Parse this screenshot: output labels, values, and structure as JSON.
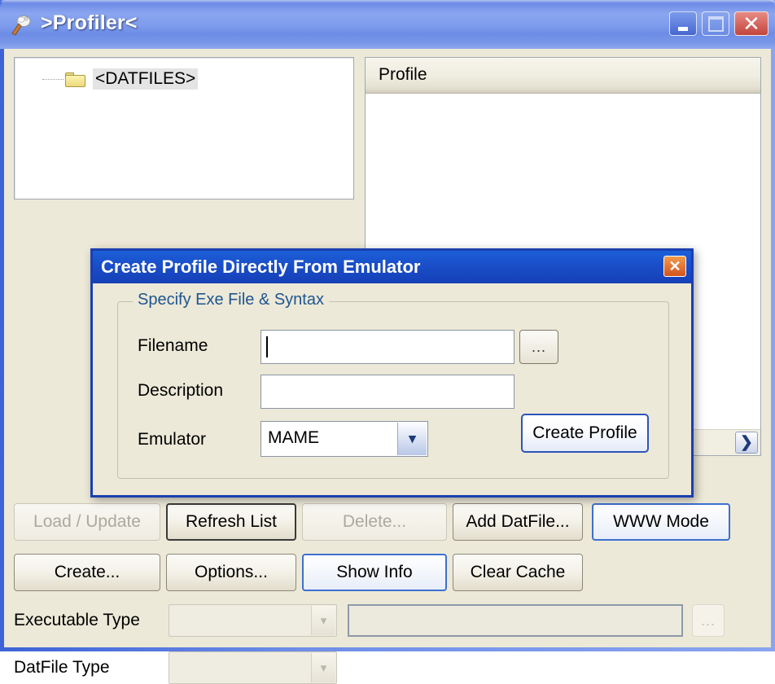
{
  "window": {
    "title": ">Profiler<",
    "icon": "app-icon",
    "controls": {
      "minimize": "minimize-icon",
      "maximize": "maximize-icon",
      "close": "close-icon"
    }
  },
  "tree_panel": {
    "nodes": [
      {
        "label": "<DATFILES>",
        "icon": "folder-icon",
        "selected": true
      }
    ]
  },
  "list_panel": {
    "column_header": "Profile",
    "rows": [],
    "hscroll_right_glyph": "❯"
  },
  "button_rows": {
    "row1": [
      {
        "label": "Load / Update",
        "state": "disabled"
      },
      {
        "label": "Refresh List",
        "state": "default"
      },
      {
        "label": "Delete...",
        "state": "disabled"
      },
      {
        "label": "Add DatFile...",
        "state": "normal"
      },
      {
        "label": "WWW Mode",
        "state": "focus"
      }
    ],
    "row2": [
      {
        "label": "Create...",
        "state": "normal"
      },
      {
        "label": "Options...",
        "state": "normal"
      },
      {
        "label": "Show Info",
        "state": "focus"
      },
      {
        "label": "Clear Cache",
        "state": "normal"
      }
    ]
  },
  "bottom_form": {
    "executable_type": {
      "label": "Executable Type",
      "value": "",
      "arrow_glyph": "▾",
      "path_value": "",
      "browse_label": "..."
    },
    "datfile_type": {
      "label": "DatFile Type",
      "value": "",
      "arrow_glyph": "▾"
    }
  },
  "dialog": {
    "title": "Create Profile Directly From Emulator",
    "close_glyph": "✖",
    "groupbox_legend": "Specify Exe File & Syntax",
    "fields": {
      "filename": {
        "label": "Filename",
        "value": "",
        "browse_label": "..."
      },
      "description": {
        "label": "Description",
        "value": ""
      },
      "emulator": {
        "label": "Emulator",
        "value": "MAME",
        "arrow_glyph": "▾"
      }
    },
    "create_button": "Create Profile"
  },
  "colors": {
    "title_bar_blue": "#6f8de8",
    "dialog_title_blue": "#1a4ec8",
    "dialog_border": "#1b3fb0",
    "client_bg": "#ece9d8",
    "legend_text": "#20558f",
    "close_red": "#c2453c",
    "focus_border": "#3e6fd0",
    "folder_yellow": "#ecd97a"
  }
}
